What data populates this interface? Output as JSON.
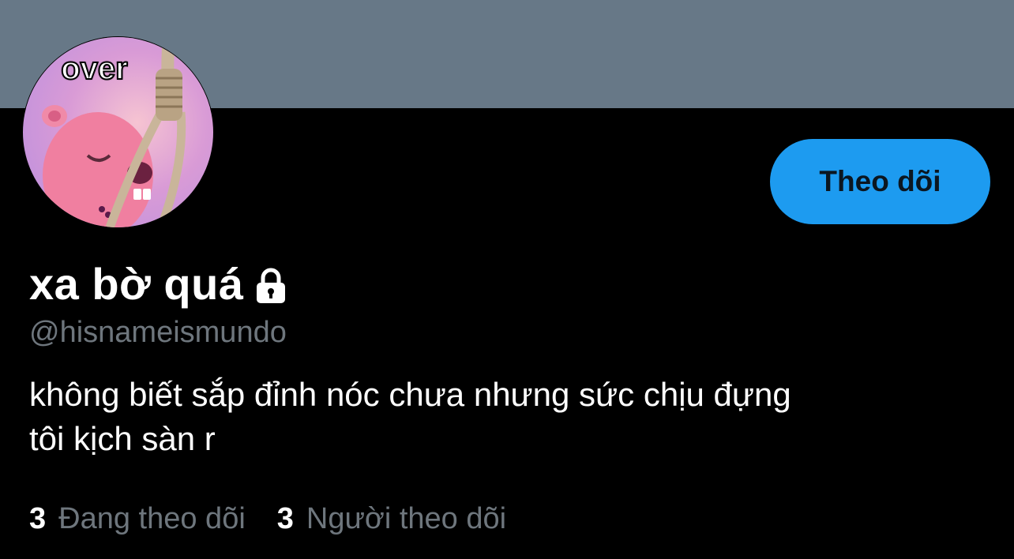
{
  "profile": {
    "avatar_caption": "over",
    "display_name": "xa bờ quá",
    "handle": "@hisnameismundo",
    "bio_line1": "không biết sắp đỉnh nóc chưa nhưng sức chịu đựng",
    "bio_line2": "tôi kịch sàn r",
    "follow_label": "Theo dõi"
  },
  "stats": {
    "following_count": "3",
    "following_label": "Đang theo dõi",
    "followers_count": "3",
    "followers_label": "Người theo dõi"
  },
  "colors": {
    "banner": "#677887",
    "background": "#000000",
    "accent": "#1d9bf0",
    "muted_text": "#6e767d"
  },
  "icons": {
    "lock": "lock-icon"
  }
}
